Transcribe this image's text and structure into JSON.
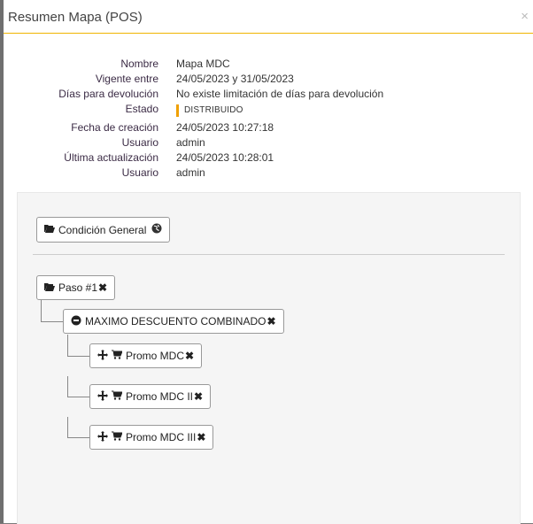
{
  "modal": {
    "title": "Resumen Mapa (POS)",
    "close": "×"
  },
  "info": [
    {
      "label": "Nombre",
      "value": "Mapa MDC"
    },
    {
      "label": "Vigente entre",
      "value": "24/05/2023 y 31/05/2023"
    },
    {
      "label": "Días para devolución",
      "value": "No existe limitación de días para devolución"
    },
    {
      "label": "Estado",
      "value": "DISTRIBUIDO"
    },
    {
      "label": "Fecha de creación",
      "value": "24/05/2023 10:27:18"
    },
    {
      "label": "Usuario",
      "value": "admin"
    },
    {
      "label": "Última actualización",
      "value": "24/05/2023 10:28:01"
    },
    {
      "label": "Usuario",
      "value": "admin"
    }
  ],
  "colors": {
    "accent": "#f0b400",
    "status": "#f0a000",
    "panel": "#f5f5f5"
  },
  "tree": {
    "general": {
      "label": "Condición General",
      "icon": "folder-open-icon",
      "badge_icon": "globe-icon"
    },
    "step": {
      "label": "Paso #1",
      "icon": "folder-open-icon",
      "remove_icon": "close-icon"
    },
    "group": {
      "label": "MAXIMO DESCUENTO COMBINADO",
      "icon": "minus-circle-icon",
      "remove_icon": "close-icon"
    },
    "promos": [
      {
        "label": "Promo MDC",
        "icons": [
          "move-icon",
          "cart-icon"
        ],
        "remove_icon": "close-icon"
      },
      {
        "label": "Promo MDC II",
        "icons": [
          "move-icon",
          "cart-icon"
        ],
        "remove_icon": "close-icon"
      },
      {
        "label": "Promo MDC III",
        "icons": [
          "move-icon",
          "cart-icon"
        ],
        "remove_icon": "close-icon"
      }
    ]
  }
}
